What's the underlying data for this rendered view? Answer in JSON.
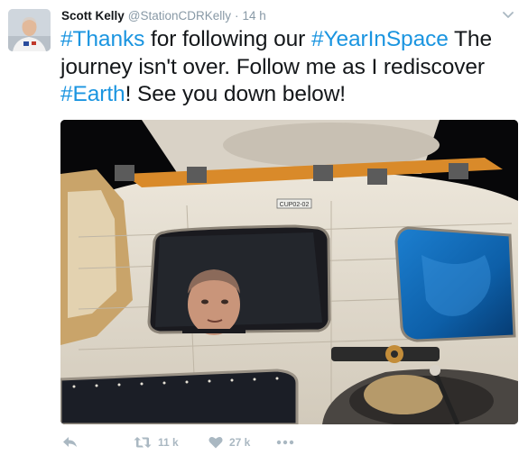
{
  "tweet": {
    "author_name": "Scott Kelly",
    "author_handle": "@StationCDRKelly",
    "separator": "·",
    "time": "14 h",
    "text_parts": [
      {
        "text": "#Thanks",
        "type": "hashtag"
      },
      {
        "text": " for following our ",
        "type": "text"
      },
      {
        "text": "#YearInSpace",
        "type": "hashtag"
      },
      {
        "text": " The journey isn't over. Follow me as I rediscover ",
        "type": "text"
      },
      {
        "text": "#Earth",
        "type": "hashtag"
      },
      {
        "text": "! See you down below!",
        "type": "text"
      }
    ]
  },
  "media": {
    "panel_label": "CUP02-02"
  },
  "actions": {
    "reply_icon": "reply-icon",
    "retweet_icon": "retweet-icon",
    "retweet_count": "11 k",
    "like_icon": "heart-icon",
    "like_count": "27 k",
    "more_icon": "more-icon"
  },
  "colors": {
    "hashtag": "#1b95e0",
    "muted": "#8899a6",
    "action": "#aab8c2"
  }
}
